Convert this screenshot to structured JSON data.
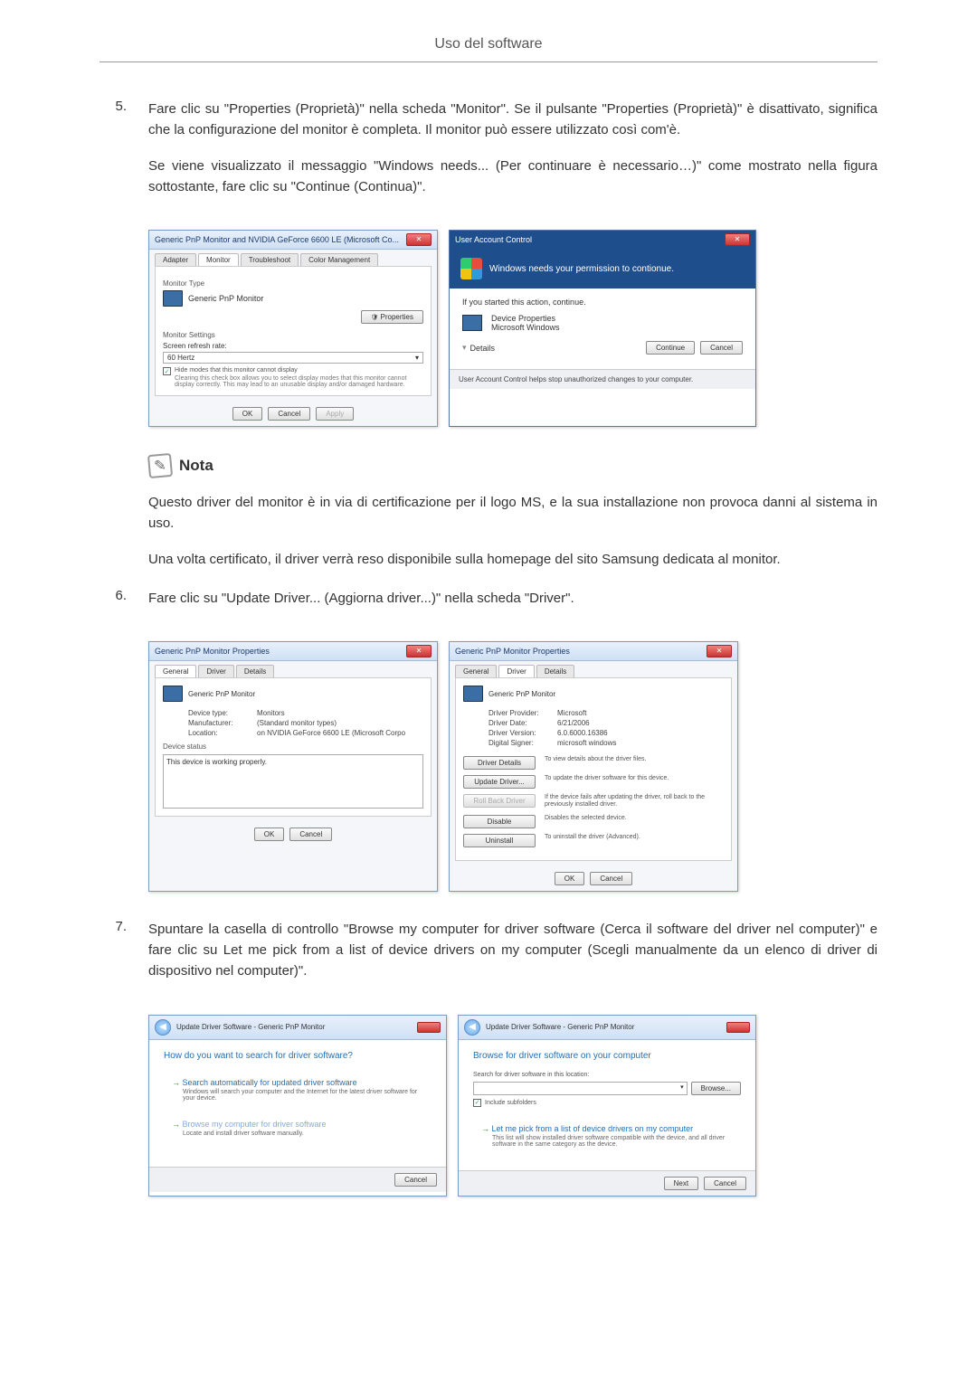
{
  "header": "Uso del software",
  "step5": {
    "num": "5.",
    "p1": "Fare clic su \"Properties (Proprietà)\" nella scheda \"Monitor\". Se il pulsante \"Properties (Proprietà)\" è disattivato, significa che la configurazione del monitor è completa. Il monitor può essere utilizzato così com'è.",
    "p2": "Se viene visualizzato il messaggio \"Windows needs... (Per continuare è necessario…)\" come mostrato nella figura sottostante, fare clic su \"Continue (Continua)\"."
  },
  "monitor_dialog": {
    "title": "Generic PnP Monitor and NVIDIA GeForce 6600 LE (Microsoft Co...",
    "tabs": {
      "adapter": "Adapter",
      "monitor": "Monitor",
      "troubleshoot": "Troubleshoot",
      "color": "Color Management"
    },
    "type_label": "Monitor Type",
    "type_value": "Generic PnP Monitor",
    "properties_btn": "Properties",
    "settings_label": "Monitor Settings",
    "refresh_label": "Screen refresh rate:",
    "refresh_value": "60 Hertz",
    "hide_label": "Hide modes that this monitor cannot display",
    "hide_help": "Clearing this check box allows you to select display modes that this monitor cannot display correctly. This may lead to an unusable display and/or damaged hardware.",
    "ok": "OK",
    "cancel": "Cancel",
    "apply": "Apply"
  },
  "uac": {
    "title": "User Account Control",
    "banner": "Windows needs your permission to contionue.",
    "started": "If you started this action, continue.",
    "prog1": "Device Properties",
    "prog2": "Microsoft Windows",
    "details": "Details",
    "continue": "Continue",
    "cancel": "Cancel",
    "footer": "User Account Control helps stop unauthorized changes to your computer."
  },
  "note": {
    "title": "Nota",
    "p1": "Questo driver del monitor è in via di certificazione per il logo MS, e la sua installazione non provoca danni al sistema in uso.",
    "p2": "Una volta certificato, il driver verrà reso disponibile sulla homepage del sito Samsung dedicata al monitor."
  },
  "step6": {
    "num": "6.",
    "text": "Fare clic su \"Update Driver... (Aggiorna driver...)\" nella scheda \"Driver\"."
  },
  "prop_general": {
    "title": "Generic PnP Monitor Properties",
    "tabs": {
      "general": "General",
      "driver": "Driver",
      "details": "Details"
    },
    "name": "Generic PnP Monitor",
    "k_type": "Device type:",
    "v_type": "Monitors",
    "k_mfr": "Manufacturer:",
    "v_mfr": "(Standard monitor types)",
    "k_loc": "Location:",
    "v_loc": "on NVIDIA GeForce 6600 LE (Microsoft Corpo",
    "status_label": "Device status",
    "status_text": "This device is working properly.",
    "ok": "OK",
    "cancel": "Cancel"
  },
  "prop_driver": {
    "title": "Generic PnP Monitor Properties",
    "name": "Generic PnP Monitor",
    "k_provider": "Driver Provider:",
    "v_provider": "Microsoft",
    "k_date": "Driver Date:",
    "v_date": "6/21/2006",
    "k_version": "Driver Version:",
    "v_version": "6.0.6000.16386",
    "k_signer": "Digital Signer:",
    "v_signer": "microsoft windows",
    "btn_details": "Driver Details",
    "d_details": "To view details about the driver files.",
    "btn_update": "Update Driver...",
    "d_update": "To update the driver software for this device.",
    "btn_rollback": "Roll Back Driver",
    "d_rollback": "If the device fails after updating the driver, roll back to the previously installed driver.",
    "btn_disable": "Disable",
    "d_disable": "Disables the selected device.",
    "btn_uninstall": "Uninstall",
    "d_uninstall": "To uninstall the driver (Advanced).",
    "ok": "OK",
    "cancel": "Cancel"
  },
  "step7": {
    "num": "7.",
    "text": "Spuntare la casella di controllo \"Browse my computer for driver software (Cerca il software del driver nel computer)\" e fare clic su Let me pick from a list of device drivers on my computer (Scegli manualmente da un elenco di driver di dispositivo nel computer)\"."
  },
  "wiz1": {
    "breadcrumb": "Update Driver Software - Generic PnP Monitor",
    "question": "How do you want to search for driver software?",
    "opt1_title": "Search automatically for updated driver software",
    "opt1_desc": "Windows will search your computer and the Internet for the latest driver software for your device.",
    "opt2_title": "Browse my computer for driver software",
    "opt2_desc": "Locate and install driver software manually.",
    "cancel": "Cancel"
  },
  "wiz2": {
    "breadcrumb": "Update Driver Software - Generic PnP Monitor",
    "heading": "Browse for driver software on your computer",
    "search_label": "Search for driver software in this location:",
    "browse": "Browse...",
    "include": "Include subfolders",
    "opt_title": "Let me pick from a list of device drivers on my computer",
    "opt_desc": "This list will show installed driver software compatible with the device, and all driver software in the same category as the device.",
    "next": "Next",
    "cancel": "Cancel"
  }
}
